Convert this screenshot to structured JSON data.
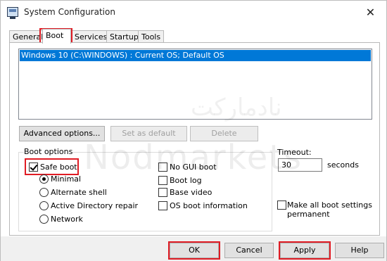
{
  "window": {
    "title": "System Configuration",
    "close_glyph": "✕"
  },
  "tabs": [
    {
      "label": "General"
    },
    {
      "label": "Boot"
    },
    {
      "label": "Services"
    },
    {
      "label": "Startup"
    },
    {
      "label": "Tools"
    }
  ],
  "active_tab": "Boot",
  "os_list": {
    "items": [
      "Windows 10 (C:\\WINDOWS) : Current OS; Default OS"
    ]
  },
  "buttons": {
    "advanced": "Advanced options...",
    "set_default": "Set as default",
    "delete": "Delete"
  },
  "boot_options": {
    "label": "Boot options",
    "safe_boot": {
      "label": "Safe boot",
      "checked": true
    },
    "modes": [
      {
        "label": "Minimal",
        "selected": true
      },
      {
        "label": "Alternate shell",
        "selected": false
      },
      {
        "label": "Active Directory repair",
        "selected": false
      },
      {
        "label": "Network",
        "selected": false
      }
    ],
    "flags": [
      {
        "label": "No GUI boot",
        "checked": false
      },
      {
        "label": "Boot log",
        "checked": false
      },
      {
        "label": "Base video",
        "checked": false
      },
      {
        "label": "OS boot information",
        "checked": false
      }
    ]
  },
  "timeout": {
    "label": "Timeout:",
    "value": "30",
    "unit": "seconds"
  },
  "permanent": {
    "label_line1": "Make all boot settings",
    "label_line2": "permanent",
    "checked": false
  },
  "footer": {
    "ok": "OK",
    "cancel": "Cancel",
    "apply": "Apply",
    "help": "Help"
  },
  "watermark": {
    "latin": "Nodmarkets",
    "arabic": "نادماركت"
  },
  "colors": {
    "highlight": "#e01c24",
    "selection": "#0078d7"
  }
}
